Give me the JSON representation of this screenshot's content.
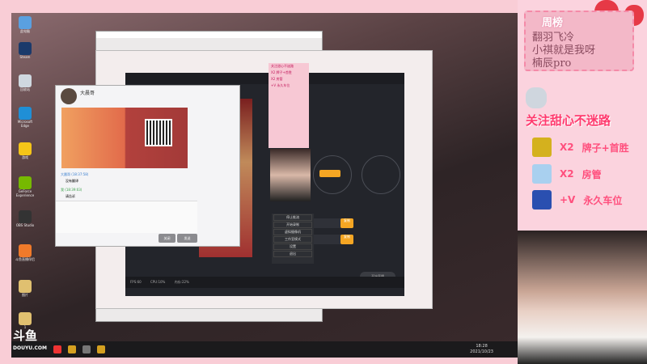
{
  "desktop": {
    "icons": [
      {
        "label": "此电脑",
        "color": "#5aa0e0"
      },
      {
        "label": "Steam",
        "color": "#1b3a6b"
      },
      {
        "label": "回收站",
        "color": "#cfd8e0"
      },
      {
        "label": "Microsoft Edge",
        "color": "#1f8fd6"
      },
      {
        "label": "游戏",
        "color": "#f5c518"
      },
      {
        "label": "GeForce Experience",
        "color": "#76b900"
      },
      {
        "label": "OBS Studio",
        "color": "#333"
      },
      {
        "label": "斗鱼直播伴侣",
        "color": "#f07a2a"
      },
      {
        "label": "图片",
        "color": "#e0c070"
      },
      {
        "label": "1",
        "color": "#e0c070"
      }
    ],
    "taskbar": {
      "time": "18:28",
      "date": "2021/10/23"
    }
  },
  "chat": {
    "contact": "大晨哥",
    "messages": [
      {
        "sender": "大晨哥 (18:37:58)",
        "text": "没有翻译"
      },
      {
        "sender": "我 (18:39:03)",
        "text": "请告诉"
      }
    ],
    "close": "关闭",
    "send": "发送"
  },
  "streamer_app": {
    "menu": [
      "停止推流",
      "开始录制",
      "虚拟摄像机",
      "工作室模式",
      "设置",
      "退出"
    ],
    "status": "FPS:60 CPU:10% 内存:22%",
    "copy": "复制",
    "dots": [
      "1",
      "2"
    ],
    "start": "开始直播"
  },
  "widget": {
    "title": "关注甜心不迷路",
    "lines": [
      "X2 牌子+首胜",
      "X2 房管",
      "+V 永久车位"
    ]
  },
  "panel": {
    "board_title": "周榜",
    "board_names": [
      "翻羽飞冷",
      "小祺就是我呀",
      "楠辰pro"
    ],
    "follow": "关注甜心不迷路",
    "gifts": [
      {
        "mult": "X2",
        "text": "牌子+首胜",
        "color": "#d4b11e"
      },
      {
        "mult": "X2",
        "text": "房管",
        "color": "#a9d0ef"
      },
      {
        "mult": "+V",
        "text": "永久车位",
        "color": "#2a4fb0"
      }
    ]
  },
  "logo": {
    "text": "斗鱼",
    "sub": "DOUYU.COM"
  }
}
